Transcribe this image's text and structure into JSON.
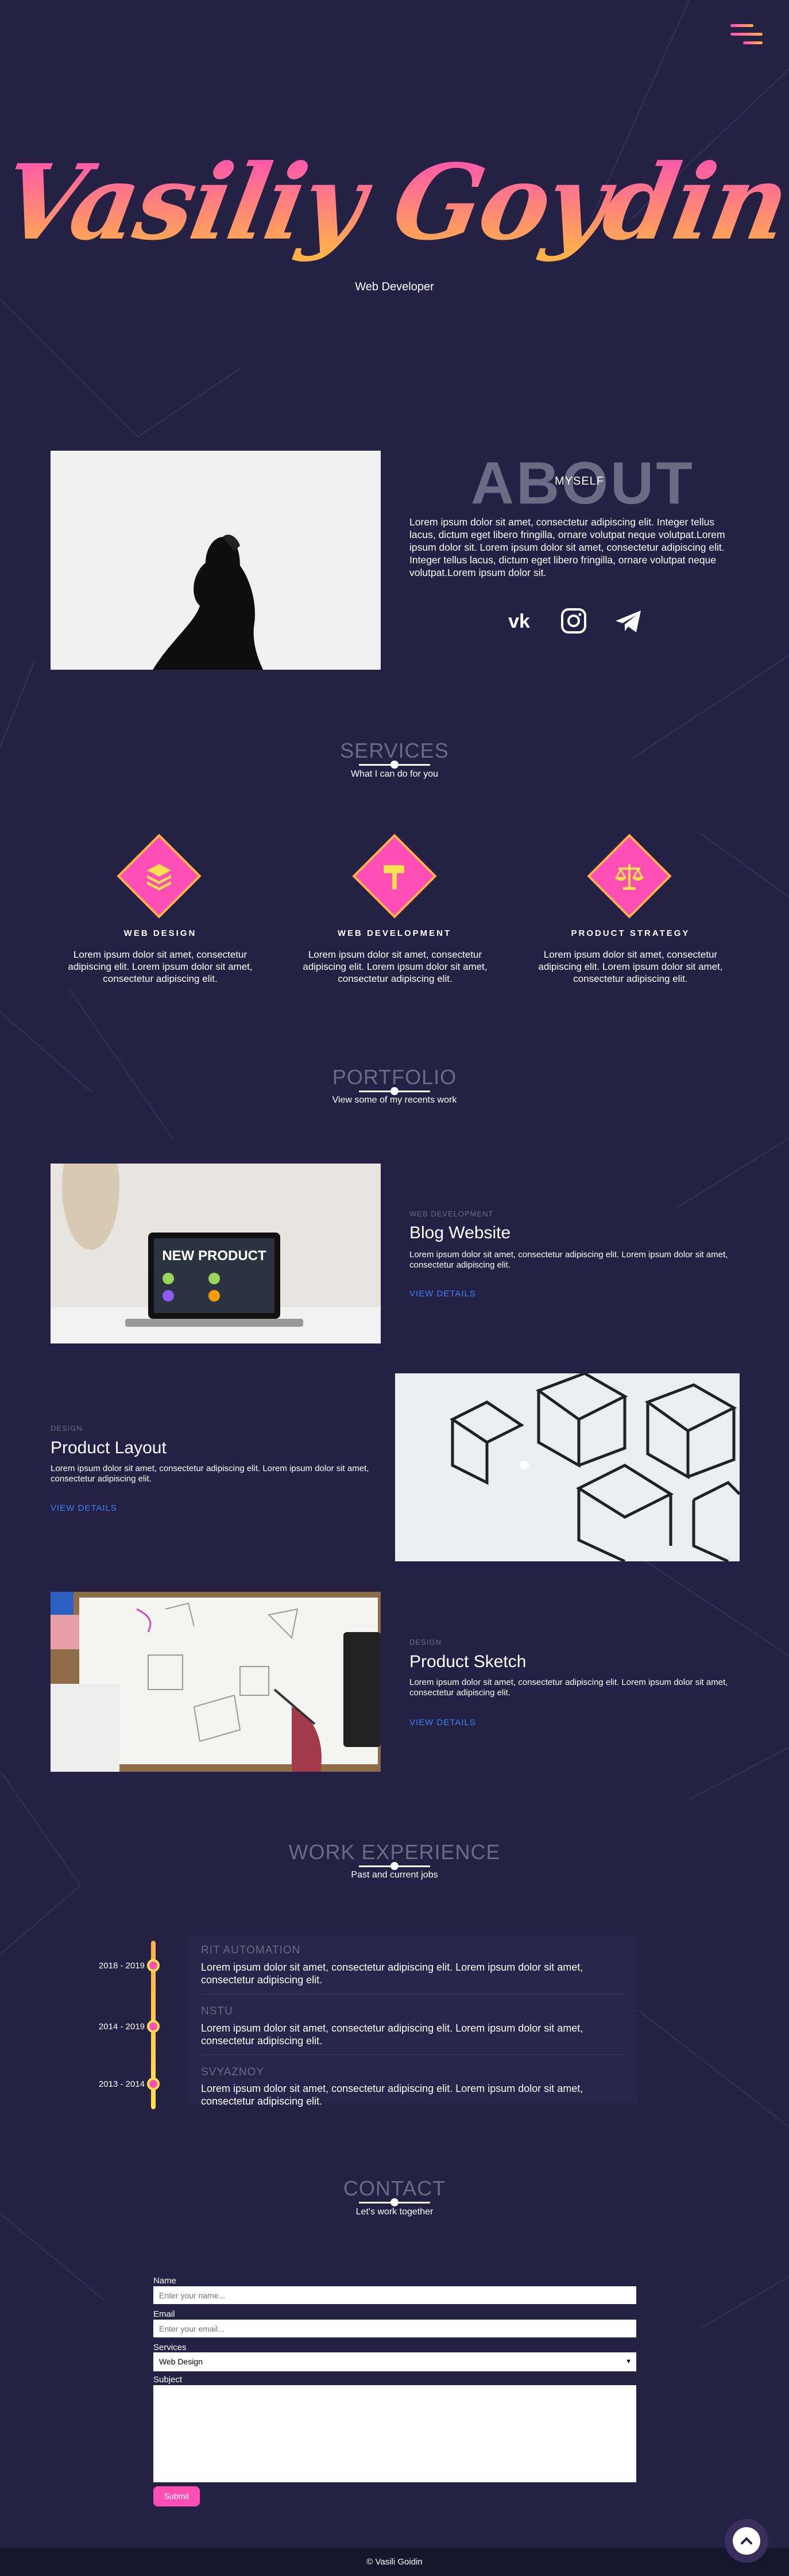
{
  "colors": {
    "bg": "#242145",
    "accent": "#ff4fb6",
    "accent2": "#ffb347",
    "link": "#3b82f6",
    "muted": "#6d6a86"
  },
  "header": {
    "menu_icon": "hamburger-gradient-icon"
  },
  "hero": {
    "name": "Vasiliy Goydin",
    "role": "Web Developer"
  },
  "about": {
    "title": "ABOUT",
    "subtitle": "MYSELF",
    "text": "Lorem ipsum dolor sit amet, consectetur adipiscing elit. Integer tellus lacus, dictum eget libero fringilla, ornare volutpat neque volutpat.Lorem ipsum dolor sit. Lorem ipsum dolor sit amet, consectetur adipiscing elit. Integer tellus lacus, dictum eget libero fringilla, ornare volutpat neque volutpat.Lorem ipsum dolor sit.",
    "social": [
      "vk-icon",
      "instagram-icon",
      "telegram-icon"
    ]
  },
  "services": {
    "title": "SERVICES",
    "subtitle": "What I can do for you",
    "items": [
      {
        "name": "WEB DESIGN",
        "icon": "layers-icon",
        "text": "Lorem ipsum dolor sit amet, consectetur adipiscing elit. Lorem ipsum dolor sit amet, consectetur adipiscing elit."
      },
      {
        "name": "WEB DEVELOPMENT",
        "icon": "hammer-icon",
        "text": "Lorem ipsum dolor sit amet, consectetur adipiscing elit. Lorem ipsum dolor sit amet, consectetur adipiscing elit."
      },
      {
        "name": "PRODUCT STRATEGY",
        "icon": "balance-scale-icon",
        "text": "Lorem ipsum dolor sit amet, consectetur adipiscing elit. Lorem ipsum dolor sit amet, consectetur adipiscing elit."
      }
    ]
  },
  "portfolio": {
    "title": "PORTFOLIO",
    "subtitle": "View some of my recents work",
    "items": [
      {
        "category": "WEB DEVELOPMENT",
        "title": "Blog Website",
        "text": "Lorem ipsum dolor sit amet, consectetur adipiscing elit. Lorem ipsum dolor sit amet, consectetur adipiscing elit.",
        "link": "VIEW DETAILS",
        "image_text": "NEW PRODUCT"
      },
      {
        "category": "DESIGN",
        "title": "Product Layout",
        "text": "Lorem ipsum dolor sit amet, consectetur adipiscing elit. Lorem ipsum dolor sit amet, consectetur adipiscing elit.",
        "link": "VIEW DETAILS"
      },
      {
        "category": "DESIGN",
        "title": "Product Sketch",
        "text": "Lorem ipsum dolor sit amet, consectetur adipiscing elit. Lorem ipsum dolor sit amet, consectetur adipiscing elit.",
        "link": "VIEW DETAILS"
      }
    ]
  },
  "work": {
    "title": "WORK EXPERIENCE",
    "subtitle": "Past and current jobs",
    "items": [
      {
        "date": "2018 - 2019",
        "company": "RIT AUTOMATION",
        "text": "Lorem ipsum dolor sit amet, consectetur adipiscing elit. Lorem ipsum dolor sit amet, consectetur adipiscing elit."
      },
      {
        "date": "2014 - 2019",
        "company": "NSTU",
        "text": "Lorem ipsum dolor sit amet, consectetur adipiscing elit. Lorem ipsum dolor sit amet, consectetur adipiscing elit."
      },
      {
        "date": "2013 - 2014",
        "company": "SVYAZNOY",
        "text": "Lorem ipsum dolor sit amet, consectetur adipiscing elit. Lorem ipsum dolor sit amet, consectetur adipiscing elit."
      }
    ]
  },
  "contact": {
    "title": "CONTACT",
    "subtitle": "Let's work together",
    "name_label": "Name",
    "name_placeholder": "Enter your name...",
    "email_label": "Email",
    "email_placeholder": "Enter your email...",
    "services_label": "Services",
    "services_value": "Web Design",
    "subject_label": "Subject",
    "submit": "Submit"
  },
  "footer": {
    "text": "© Vasili Goidin"
  },
  "scroll_top": {
    "icon": "chevron-up-icon"
  }
}
